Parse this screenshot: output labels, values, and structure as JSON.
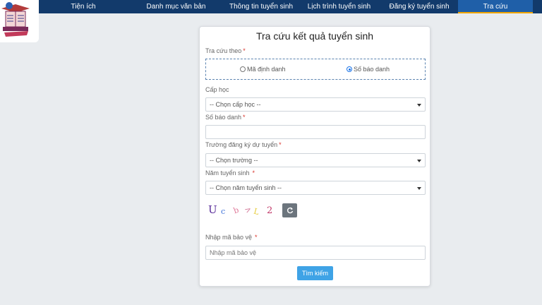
{
  "nav": {
    "items": [
      {
        "label": "Tiện ích"
      },
      {
        "label": "Danh mục văn bản"
      },
      {
        "label": "Thông tin tuyển sinh"
      },
      {
        "label": "Lịch trình tuyển sinh"
      },
      {
        "label": "Đăng ký tuyển sinh"
      },
      {
        "label": "Tra cứu"
      }
    ],
    "active_index": 5
  },
  "form": {
    "title": "Tra cứu kết quả tuyển sinh",
    "lookup_by_label": "Tra cứu theo",
    "radio_options": [
      {
        "label": "Mã định danh",
        "checked": false
      },
      {
        "label": "Số báo danh",
        "checked": true
      }
    ],
    "level_label": "Cấp học",
    "level_value": "-- Chọn cấp học --",
    "candidate_no_label": "Số báo danh",
    "candidate_no_value": "",
    "school_label": "Trường đăng ký dự tuyển",
    "school_value": "-- Chọn trường --",
    "year_label": "Năm tuyển sinh",
    "year_value": "-- Chọn năm tuyển sinh --",
    "captcha_chars": [
      "U",
      "c",
      "b",
      ">",
      "L",
      "2"
    ],
    "security_label": "Nhập mã bảo vệ",
    "security_placeholder": "Nhập mã bảo vệ",
    "submit_label": "Tìm kiếm",
    "required_mark": "*"
  },
  "colors": {
    "nav_bg": "#123a6b",
    "nav_active": "#1f5fa8",
    "nav_active_underline": "#f0a500",
    "button": "#3fa3e6",
    "required": "#d9342b"
  },
  "icons": {
    "refresh": "refresh-icon",
    "logo": "school-logo"
  }
}
